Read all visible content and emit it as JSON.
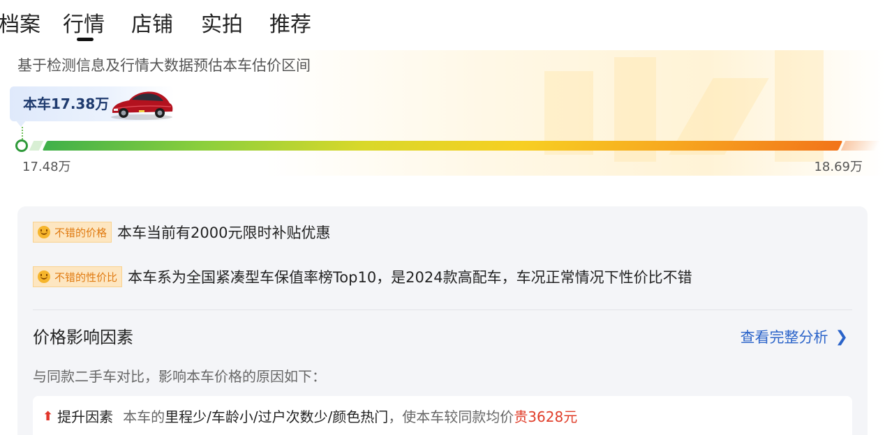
{
  "tabs": [
    {
      "label": "档案",
      "active": false
    },
    {
      "label": "行情",
      "active": true
    },
    {
      "label": "店铺",
      "active": false
    },
    {
      "label": "实拍",
      "active": false
    },
    {
      "label": "推荐",
      "active": false
    }
  ],
  "estimate": {
    "subtitle": "基于检测信息及行情大数据预估本车估价区间",
    "this_car_price": "本车17.38万",
    "range_min": "17.48万",
    "range_max": "18.69万",
    "car_image_icon": "red-sedan-car-image"
  },
  "highlights": [
    {
      "tag": "不错的价格",
      "icon": "smile-icon",
      "text": "本车当前有2000元限时补贴优惠"
    },
    {
      "tag": "不错的性价比",
      "icon": "smile-icon",
      "text": "本车系为全国紧凑型车保值率榜Top10，是2024款高配车，车况正常情况下性价比不错"
    }
  ],
  "factors": {
    "title": "价格影响因素",
    "link_label": "查看完整分析",
    "link_icon": "chevron-right-icon",
    "description": "与同款二手车对比，影响本车价格的原因如下：",
    "rise": {
      "kind": "提升因素",
      "icon": "arrow-up-icon",
      "prefix": "本车的",
      "reasons": "里程少/车龄小/过户次数少/颜色热门",
      "middle": "，使本车较同款均价",
      "diff": "贵3628元"
    }
  },
  "colors": {
    "accent_link": "#2a63c9",
    "price_up": "#e03c28",
    "tag_bg": "#fde6c1",
    "tag_text": "#e07a10",
    "range_start": "#3fb04a",
    "range_end": "#f2741a"
  }
}
